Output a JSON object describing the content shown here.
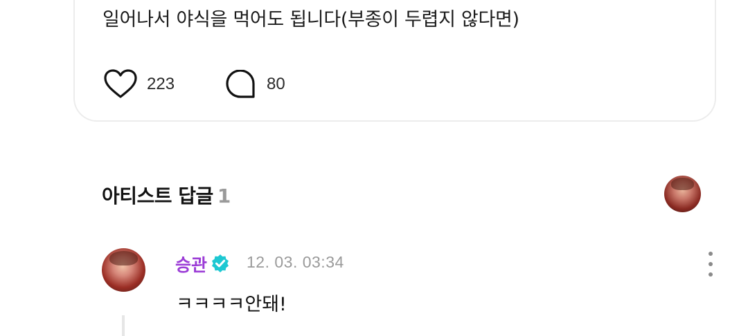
{
  "post": {
    "text": "일어나서 야식을 먹어도 됩니다(부종이 두렵지 않다면)",
    "like_count": "223",
    "comment_count": "80"
  },
  "artist_replies": {
    "title": "아티스트 답글",
    "count": "1"
  },
  "reply": {
    "author": "승관",
    "timestamp": "12. 03. 03:34",
    "text": "ㅋㅋㅋㅋ안돼!",
    "author_color": "#9b3cd6",
    "verified_color": "#1ec8d2"
  },
  "icons": [
    "heart-icon",
    "comment-bubble-icon",
    "verified-badge-icon",
    "more-options-icon"
  ]
}
